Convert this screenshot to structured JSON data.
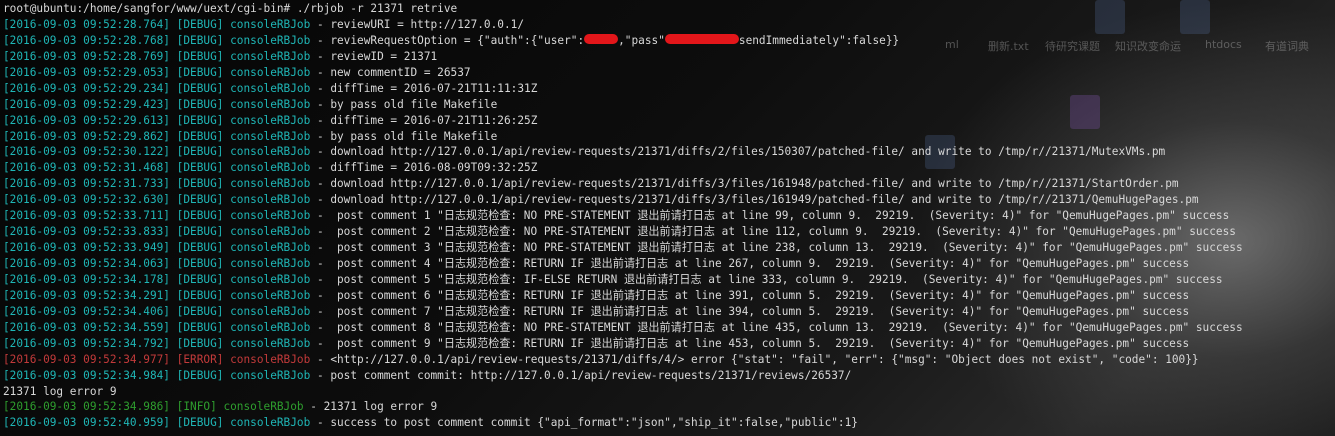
{
  "terminal": {
    "prompt": "root@ubuntu:/home/sangfor/www/uext/cgi-bin# ./rbjob -r 21371 retrive",
    "desktop_labels": [
      "ml",
      "删新.txt",
      "待研究课题",
      "知识改变命运",
      "htdocs",
      "有道词典"
    ],
    "lines": [
      {
        "ts": "[2016-09-03 09:52:28.764]",
        "level": "[DEBUG]",
        "src": "consoleRBJob",
        "msg": " - reviewURI = http://127.0.0.1/"
      },
      {
        "ts": "[2016-09-03 09:52:28.768]",
        "level": "[DEBUG]",
        "src": "consoleRBJob",
        "msg": " - reviewRequestOption = {\"auth\":{\"user\":",
        "redacted": true,
        "msg_mid": ",\"pass\"",
        "msg_tail": "sendImmediately\":false}}"
      },
      {
        "ts": "[2016-09-03 09:52:28.769]",
        "level": "[DEBUG]",
        "src": "consoleRBJob",
        "msg": " - reviewID = 21371"
      },
      {
        "ts": "[2016-09-03 09:52:29.053]",
        "level": "[DEBUG]",
        "src": "consoleRBJob",
        "msg": " - new commentID = 26537"
      },
      {
        "ts": "[2016-09-03 09:52:29.234]",
        "level": "[DEBUG]",
        "src": "consoleRBJob",
        "msg": " - diffTime = 2016-07-21T11:11:31Z"
      },
      {
        "ts": "[2016-09-03 09:52:29.423]",
        "level": "[DEBUG]",
        "src": "consoleRBJob",
        "msg": " - by pass old file Makefile"
      },
      {
        "ts": "[2016-09-03 09:52:29.613]",
        "level": "[DEBUG]",
        "src": "consoleRBJob",
        "msg": " - diffTime = 2016-07-21T11:26:25Z"
      },
      {
        "ts": "[2016-09-03 09:52:29.862]",
        "level": "[DEBUG]",
        "src": "consoleRBJob",
        "msg": " - by pass old file Makefile"
      },
      {
        "ts": "[2016-09-03 09:52:30.122]",
        "level": "[DEBUG]",
        "src": "consoleRBJob",
        "msg": " - download http://127.0.0.1/api/review-requests/21371/diffs/2/files/150307/patched-file/ and write to /tmp/r//21371/MutexVMs.pm"
      },
      {
        "ts": "[2016-09-03 09:52:31.468]",
        "level": "[DEBUG]",
        "src": "consoleRBJob",
        "msg": " - diffTime = 2016-08-09T09:32:25Z"
      },
      {
        "ts": "[2016-09-03 09:52:31.733]",
        "level": "[DEBUG]",
        "src": "consoleRBJob",
        "msg": " - download http://127.0.0.1/api/review-requests/21371/diffs/3/files/161948/patched-file/ and write to /tmp/r//21371/StartOrder.pm"
      },
      {
        "ts": "[2016-09-03 09:52:32.630]",
        "level": "[DEBUG]",
        "src": "consoleRBJob",
        "msg": " - download http://127.0.0.1/api/review-requests/21371/diffs/3/files/161949/patched-file/ and write to /tmp/r//21371/QemuHugePages.pm"
      },
      {
        "ts": "[2016-09-03 09:52:33.711]",
        "level": "[DEBUG]",
        "src": "consoleRBJob",
        "msg": " -  post comment 1 \"日志规范检查: NO PRE-STATEMENT 退出前请打日志 at line 99, column 9.  29219.  (Severity: 4)\" for \"QemuHugePages.pm\" success"
      },
      {
        "ts": "[2016-09-03 09:52:33.833]",
        "level": "[DEBUG]",
        "src": "consoleRBJob",
        "msg": " -  post comment 2 \"日志规范检查: NO PRE-STATEMENT 退出前请打日志 at line 112, column 9.  29219.  (Severity: 4)\" for \"QemuHugePages.pm\" success"
      },
      {
        "ts": "[2016-09-03 09:52:33.949]",
        "level": "[DEBUG]",
        "src": "consoleRBJob",
        "msg": " -  post comment 3 \"日志规范检查: NO PRE-STATEMENT 退出前请打日志 at line 238, column 13.  29219.  (Severity: 4)\" for \"QemuHugePages.pm\" success"
      },
      {
        "ts": "[2016-09-03 09:52:34.063]",
        "level": "[DEBUG]",
        "src": "consoleRBJob",
        "msg": " -  post comment 4 \"日志规范检查: RETURN IF 退出前请打日志 at line 267, column 9.  29219.  (Severity: 4)\" for \"QemuHugePages.pm\" success"
      },
      {
        "ts": "[2016-09-03 09:52:34.178]",
        "level": "[DEBUG]",
        "src": "consoleRBJob",
        "msg": " -  post comment 5 \"日志规范检查: IF-ELSE RETURN 退出前请打日志 at line 333, column 9.  29219.  (Severity: 4)\" for \"QemuHugePages.pm\" success"
      },
      {
        "ts": "[2016-09-03 09:52:34.291]",
        "level": "[DEBUG]",
        "src": "consoleRBJob",
        "msg": " -  post comment 6 \"日志规范检查: RETURN IF 退出前请打日志 at line 391, column 5.  29219.  (Severity: 4)\" for \"QemuHugePages.pm\" success"
      },
      {
        "ts": "[2016-09-03 09:52:34.406]",
        "level": "[DEBUG]",
        "src": "consoleRBJob",
        "msg": " -  post comment 7 \"日志规范检查: RETURN IF 退出前请打日志 at line 394, column 5.  29219.  (Severity: 4)\" for \"QemuHugePages.pm\" success"
      },
      {
        "ts": "[2016-09-03 09:52:34.559]",
        "level": "[DEBUG]",
        "src": "consoleRBJob",
        "msg": " -  post comment 8 \"日志规范检查: NO PRE-STATEMENT 退出前请打日志 at line 435, column 13.  29219.  (Severity: 4)\" for \"QemuHugePages.pm\" success"
      },
      {
        "ts": "[2016-09-03 09:52:34.792]",
        "level": "[DEBUG]",
        "src": "consoleRBJob",
        "msg": " -  post comment 9 \"日志规范检查: RETURN IF 退出前请打日志 at line 453, column 5.  29219.  (Severity: 4)\" for \"QemuHugePages.pm\" success"
      },
      {
        "ts": "[2016-09-03 09:52:34.977]",
        "level": "[ERROR]",
        "src": "consoleRBJob",
        "msg": " - <http://127.0.0.1/api/review-requests/21371/diffs/4/> error {\"stat\": \"fail\", \"err\": {\"msg\": \"Object does not exist\", \"code\": 100}}",
        "style": "error"
      },
      {
        "ts": "[2016-09-03 09:52:34.984]",
        "level": "[DEBUG]",
        "src": "consoleRBJob",
        "msg": " - post comment commit: http://127.0.0.1/api/review-requests/21371/reviews/26537/"
      },
      {
        "plain": "21371 log error 9"
      },
      {
        "ts": "[2016-09-03 09:52:34.986]",
        "level": "[INFO]",
        "src": "consoleRBJob",
        "msg": " - 21371 log error 9",
        "style": "info"
      },
      {
        "ts": "[2016-09-03 09:52:40.959]",
        "level": "[DEBUG]",
        "src": "consoleRBJob",
        "msg": " - success to post comment commit {\"api_format\":\"json\",\"ship_it\":false,\"public\":1}"
      }
    ]
  },
  "colors": {
    "debug": "#1fb6b6",
    "error": "#c23a3a",
    "info": "#2e9e2e",
    "text": "#d8d8d8",
    "redaction": "#e3161a"
  }
}
